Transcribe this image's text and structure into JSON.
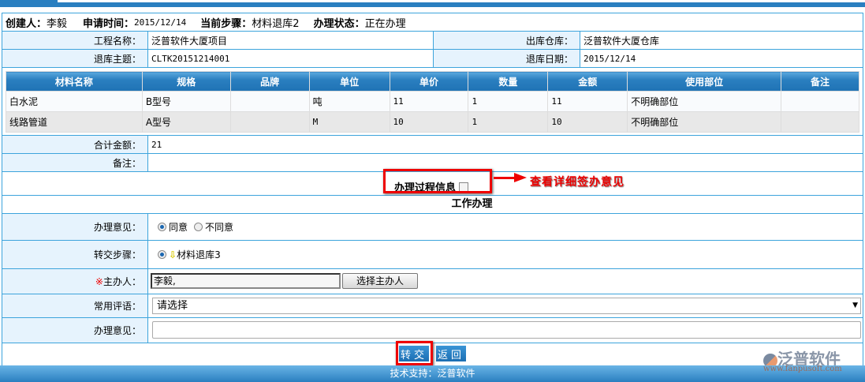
{
  "header": {
    "creator_label": "创建人：",
    "creator": "李毅",
    "apply_time_label": "申请时间：",
    "apply_time": "2015/12/14",
    "step_label": "当前步骤：",
    "step": "材料退库2",
    "status_label": "办理状态：",
    "status": "正在办理"
  },
  "form": {
    "project_label": "工程名称：",
    "project": "泛普软件大厦项目",
    "warehouse_label": "出库仓库：",
    "warehouse": "泛普软件大厦仓库",
    "subject_label": "退库主题：",
    "subject": "CLTK20151214001",
    "date_label": "退库日期：",
    "date": "2015/12/14"
  },
  "materials": {
    "columns": [
      "材料名称",
      "规格",
      "品牌",
      "单位",
      "单价",
      "数量",
      "金额",
      "使用部位",
      "备注"
    ],
    "rows": [
      [
        "白水泥",
        "B型号",
        "",
        "吨",
        "11",
        "1",
        "11",
        "不明确部位",
        ""
      ],
      [
        "线路管道",
        "A型号",
        "",
        "M",
        "10",
        "1",
        "10",
        "不明确部位",
        ""
      ]
    ]
  },
  "total_label": "合计金额：",
  "total": "21",
  "remark_label": "备注：",
  "process_info_label": "办理过程信息",
  "annotation": "查看详细签办意见",
  "work_title": "工作办理",
  "opinion_label": "办理意见：",
  "agree": "同意",
  "disagree": "不同意",
  "transfer_label": "转交步骤：",
  "transfer_step": "材料退库3",
  "handler_label": "主办人：",
  "required_mark": "※",
  "handler": "李毅,",
  "select_handler": "选择主办人",
  "common_label": "常用评语：",
  "common_value": "请选择",
  "opinion_text_label": "办理意见：",
  "opinion_text": "",
  "submit": "转交",
  "back": "返回",
  "logo_text": "泛普软件",
  "logo_url": "www.fanpusoft.com",
  "footer": "技术支持：泛普软件"
}
